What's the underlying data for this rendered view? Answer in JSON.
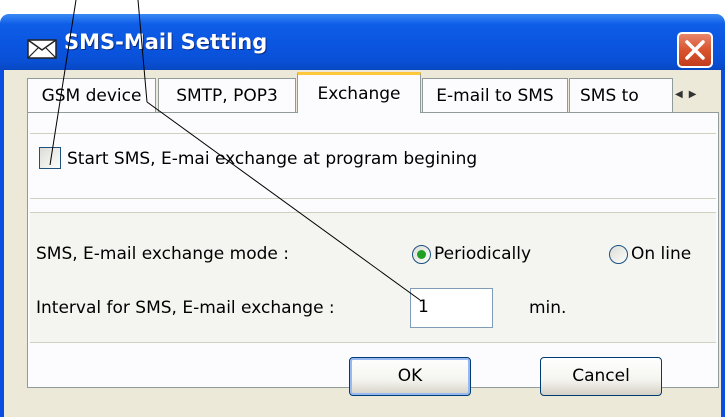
{
  "window": {
    "title": "SMS-Mail Setting",
    "icon": "envelope-icon",
    "close_icon": "close-icon"
  },
  "tabs": [
    {
      "label": "GSM device",
      "active": false
    },
    {
      "label": "SMTP, POP3",
      "active": false
    },
    {
      "label": "Exchange",
      "active": true
    },
    {
      "label": "E-mail to SMS",
      "active": false
    },
    {
      "label": "SMS to",
      "active": false
    }
  ],
  "tab_scroll": {
    "left": "◀",
    "right": "▶"
  },
  "exchange": {
    "start_checkbox": {
      "label": "Start SMS, E-mai exchange at program begining",
      "checked": false
    },
    "mode_label": "SMS, E-mail exchange mode :",
    "mode_options": [
      {
        "label": "Periodically",
        "selected": true
      },
      {
        "label": "On line",
        "selected": false
      }
    ],
    "interval_label": "Interval for SMS, E-mail exchange :",
    "interval_value": "1",
    "interval_unit": "min."
  },
  "buttons": {
    "ok": "OK",
    "cancel": "Cancel"
  },
  "colors": {
    "titlebar": "#0a55e0",
    "client": "#ece9d8",
    "close": "#d9542e",
    "radio_dot": "#21a121",
    "tab_highlight": "#ffc83c"
  }
}
